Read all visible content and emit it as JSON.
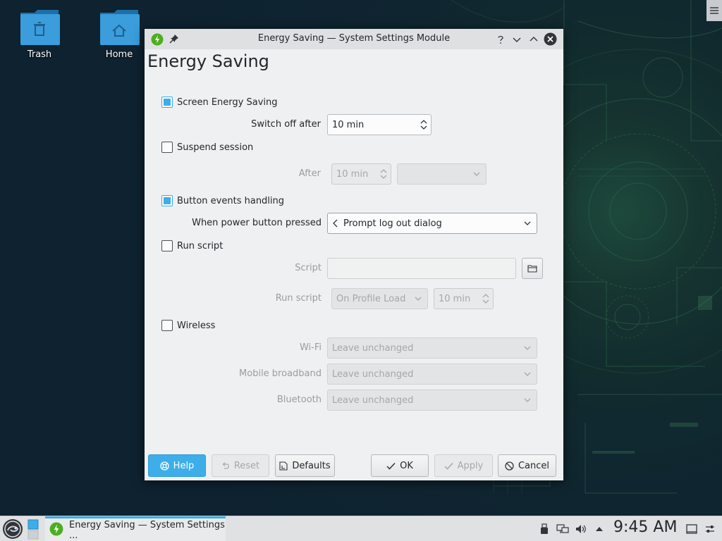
{
  "desktop": {
    "icons": [
      {
        "label": "Trash"
      },
      {
        "label": "Home"
      }
    ]
  },
  "window": {
    "title": "Energy Saving — System Settings Module",
    "page_title": "Energy Saving"
  },
  "settings": {
    "screen_energy_saving": {
      "label": "Screen Energy Saving",
      "checked": true
    },
    "switch_off_after": {
      "label": "Switch off after",
      "value": "10 min"
    },
    "suspend_session": {
      "label": "Suspend session",
      "checked": false
    },
    "suspend_after": {
      "label": "After",
      "value": "10 min",
      "action": ""
    },
    "button_events": {
      "label": "Button events handling",
      "checked": true
    },
    "power_button": {
      "label": "When power button pressed",
      "value": "Prompt log out dialog"
    },
    "run_script": {
      "label": "Run script",
      "checked": false
    },
    "script": {
      "label": "Script",
      "value": ""
    },
    "run_script_when": {
      "label": "Run script",
      "value": "On Profile Load",
      "delay": "10 min"
    },
    "wireless": {
      "label": "Wireless",
      "checked": false
    },
    "wifi": {
      "label": "Wi-Fi",
      "value": "Leave unchanged"
    },
    "mobile_broadband": {
      "label": "Mobile broadband",
      "value": "Leave unchanged"
    },
    "bluetooth": {
      "label": "Bluetooth",
      "value": "Leave unchanged"
    }
  },
  "buttons": {
    "help": "Help",
    "reset": "Reset",
    "defaults": "Defaults",
    "ok": "OK",
    "apply": "Apply",
    "cancel": "Cancel"
  },
  "taskbar": {
    "task_label": "Energy Saving — System Settings ...",
    "clock": "9:45 AM"
  },
  "colors": {
    "accent": "#3daee9",
    "window_bg": "#eff0f1",
    "titlebar_bg": "#dee0e2",
    "app_icon_green": "#4caf1e",
    "desktop_bg": "#0f2530"
  }
}
